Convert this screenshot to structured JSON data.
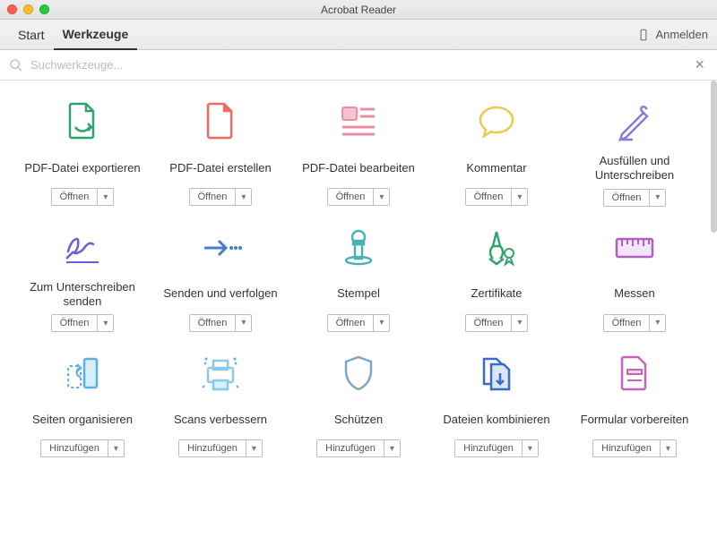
{
  "window": {
    "title": "Acrobat Reader"
  },
  "tabs": {
    "start": "Start",
    "tools": "Werkzeuge",
    "signin": "Anmelden"
  },
  "search": {
    "placeholder": "Suchwerkzeuge..."
  },
  "button": {
    "open": "Öffnen",
    "add": "Hinzufügen"
  },
  "tools": [
    {
      "label": "PDF-Datei exportieren",
      "action": "open"
    },
    {
      "label": "PDF-Datei erstellen",
      "action": "open"
    },
    {
      "label": "PDF-Datei bearbeiten",
      "action": "open"
    },
    {
      "label": "Kommentar",
      "action": "open"
    },
    {
      "label": "Ausfüllen und Unterschreiben",
      "action": "open"
    },
    {
      "label": "Zum Unterschreiben senden",
      "action": "open"
    },
    {
      "label": "Senden und verfolgen",
      "action": "open"
    },
    {
      "label": "Stempel",
      "action": "open"
    },
    {
      "label": "Zertifikate",
      "action": "open"
    },
    {
      "label": "Messen",
      "action": "open"
    },
    {
      "label": "Seiten organisieren",
      "action": "add"
    },
    {
      "label": "Scans verbessern",
      "action": "add"
    },
    {
      "label": "Schützen",
      "action": "add"
    },
    {
      "label": "Dateien kombinieren",
      "action": "add"
    },
    {
      "label": "Formular vorbereiten",
      "action": "add"
    }
  ],
  "colors": {
    "green": "#2fa36b",
    "red": "#ee6b61",
    "pink": "#e88fa6",
    "yellow": "#e9c94f",
    "blue": "#4b7bd1",
    "purple": "#8d7bd4",
    "teal": "#49b3b3",
    "darkblue": "#3a6cc7",
    "violet": "#b15fc1",
    "skyblue": "#5cb0e0",
    "lightblue": "#8ac9e8",
    "grayblue": "#7fa6c9"
  }
}
